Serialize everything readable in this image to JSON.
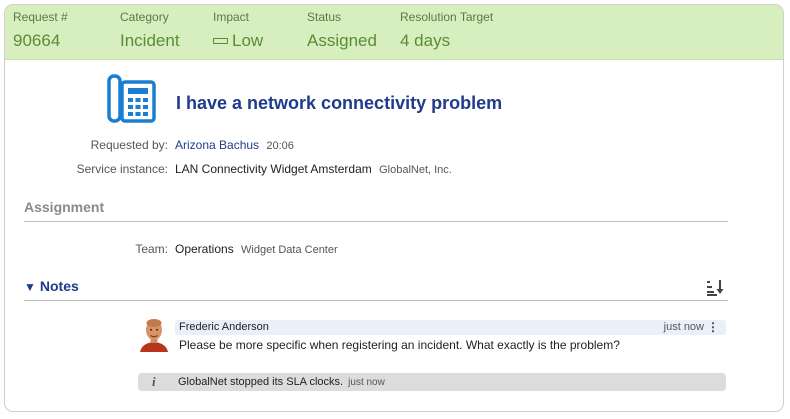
{
  "summary": {
    "request": {
      "label": "Request #",
      "value": "90664"
    },
    "category": {
      "label": "Category",
      "value": "Incident"
    },
    "impact": {
      "label": "Impact",
      "value": "Low"
    },
    "status": {
      "label": "Status",
      "value": "Assigned"
    },
    "resolution": {
      "label": "Resolution Target",
      "value": "4 days"
    }
  },
  "request": {
    "icon": "phone-icon",
    "title": "I have a network connectivity problem",
    "requested_by_label": "Requested by:",
    "requested_by_name": "Arizona Bachus",
    "requested_by_time": "20:06",
    "service_instance_label": "Service instance:",
    "service_instance_value": "LAN Connectivity Widget Amsterdam",
    "service_instance_org": "GlobalNet, Inc."
  },
  "assignment": {
    "heading": "Assignment",
    "team_label": "Team:",
    "team_value": "Operations",
    "team_sub": "Widget Data Center"
  },
  "notes": {
    "toggle": "▼",
    "heading": "Notes",
    "sort_icon": "sort-descending-icon",
    "items": [
      {
        "author": "Frederic Anderson",
        "time": "just now",
        "menu": "⋮",
        "text": "Please be more specific when registering an incident. What exactly is the problem?"
      }
    ],
    "system_message": {
      "icon": "info-icon",
      "glyph": "i",
      "text": "GlobalNet stopped its SLA clocks.",
      "time": "just now"
    }
  },
  "colors": {
    "summary_bg": "#d7efbf",
    "summary_text": "#5a8c37",
    "accent": "#1f3b8a",
    "phone_icon": "#1a7fd1"
  }
}
